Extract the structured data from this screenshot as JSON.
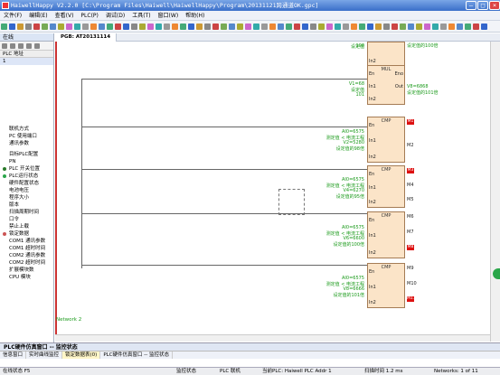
{
  "window": {
    "title": "HaiwellHappy V2.2.0 [C:\\Program Files\\Haiwell\\HaiwellHappy\\Program\\20131121跨通道OK.gpc]"
  },
  "menu": [
    "文件(F)",
    "编辑(E)",
    "查看(V)",
    "PLC(P)",
    "调试(D)",
    "工具(T)",
    "窗口(W)",
    "帮助(H)"
  ],
  "sidebar": {
    "header": "在线",
    "grid_header": "PLC 地址",
    "grid_row": "1",
    "items": [
      {
        "label": "联机方式",
        "dot": ""
      },
      {
        "label": "PC 使用端口",
        "dot": ""
      },
      {
        "label": "通讯参数",
        "dot": ""
      },
      {
        "label": "",
        "dot": ""
      },
      {
        "label": "目标PLC配置",
        "dot": ""
      },
      {
        "label": "PN",
        "dot": ""
      },
      {
        "label": "PLC 开关位置",
        "dot": "#2a7a2a"
      },
      {
        "label": "PLC运行状态",
        "dot": "#2aa64a"
      },
      {
        "label": "硬件配置状态",
        "dot": ""
      },
      {
        "label": "电池电压",
        "dot": ""
      },
      {
        "label": "程序大小",
        "dot": ""
      },
      {
        "label": "版本",
        "dot": ""
      },
      {
        "label": "扫描周期时间",
        "dot": ""
      },
      {
        "label": "口令",
        "dot": ""
      },
      {
        "label": "禁止上载",
        "dot": ""
      },
      {
        "label": "锁定数据",
        "dot": "#c55"
      },
      {
        "label": "COM1 通讯参数",
        "dot": ""
      },
      {
        "label": "COM1 超时时间",
        "dot": ""
      },
      {
        "label": "COM2 通讯参数",
        "dot": ""
      },
      {
        "label": "COM2 超时时间",
        "dot": ""
      },
      {
        "label": "扩展模块数",
        "dot": ""
      },
      {
        "label": "CPU 模块",
        "dot": ""
      }
    ]
  },
  "editor": {
    "tab": "PGB: AT20131114",
    "network_label": "Network 2",
    "blocks": [
      {
        "title": "",
        "in1": "",
        "in2": "In2",
        "en": "",
        "outs": [],
        "ops": [
          {
            "t": "设定值",
            "c": "#1a9a1a"
          },
          {
            "t": "100",
            "c": "#1a9a1a"
          }
        ],
        "right": "设定值的100倍"
      },
      {
        "title": "MUL",
        "in1": "In1",
        "in2": "In2",
        "en": "En",
        "eno": "Eno",
        "out": "Out",
        "ops": [
          {
            "t": "V1=68",
            "c": "#1a9a1a"
          },
          {
            "t": "设定值",
            "c": "#1a9a1a"
          },
          {
            "t": "101",
            "c": "#1a9a1a"
          }
        ],
        "right1": "V8=6868",
        "right2": "设定值的101倍"
      },
      {
        "title": "CMP",
        "in1": "In1",
        "in2": "In2",
        "en": "En",
        "outs": [
          {
            "t": "M1",
            "red": true
          },
          {
            "t": "M2",
            "red": false
          }
        ],
        "ops": [
          {
            "t": "AI0=6575",
            "c": "#1a9a1a"
          },
          {
            "t": "测定值 < 电流工程",
            "c": "#1a9a1a"
          },
          {
            "t": "V2=5280",
            "c": "#1a9a1a"
          },
          {
            "t": "设定值的98倍",
            "c": "#1a9a1a"
          }
        ]
      },
      {
        "title": "CMP",
        "in1": "In1",
        "in2": "In2",
        "en": "En",
        "outs": [
          {
            "t": "M3",
            "red": true
          },
          {
            "t": "M4",
            "red": false
          },
          {
            "t": "M5",
            "red": false
          }
        ],
        "ops": [
          {
            "t": "AI0=6575",
            "c": "#1a9a1a"
          },
          {
            "t": "测定值 < 电流工程",
            "c": "#1a9a1a"
          },
          {
            "t": "V4=6270",
            "c": "#1a9a1a"
          },
          {
            "t": "设定值的95倍",
            "c": "#1a9a1a"
          }
        ]
      },
      {
        "title": "CMP",
        "in1": "In1",
        "in2": "In2",
        "en": "En",
        "outs": [
          {
            "t": "M6",
            "red": false
          },
          {
            "t": "M7",
            "red": false
          },
          {
            "t": "M8",
            "red": true
          }
        ],
        "ops": [
          {
            "t": "AI0=6575",
            "c": "#1a9a1a"
          },
          {
            "t": "测定值 < 电流工程",
            "c": "#1a9a1a"
          },
          {
            "t": "V6=6600",
            "c": "#1a9a1a"
          },
          {
            "t": "设定值的100倍",
            "c": "#1a9a1a"
          }
        ]
      },
      {
        "title": "CMP",
        "in1": "In1",
        "in2": "In2",
        "en": "En",
        "outs": [
          {
            "t": "M9",
            "red": false
          },
          {
            "t": "M10",
            "red": false
          },
          {
            "t": "M11",
            "red": true
          }
        ],
        "ops": [
          {
            "t": "AI0=6575",
            "c": "#1a9a1a"
          },
          {
            "t": "测定值 < 电流工程",
            "c": "#1a9a1a"
          },
          {
            "t": "V8=6666",
            "c": "#1a9a1a"
          },
          {
            "t": "设定值的101倍",
            "c": "#1a9a1a"
          }
        ]
      }
    ]
  },
  "bottom": {
    "title": "PLC硬件仿真窗口 -- 监控状态",
    "tabs": [
      "信息窗口",
      "实时曲线监控",
      "锁定数据表(0)",
      "PLC硬件仿真窗口 -- 监控状态"
    ]
  },
  "status": {
    "device": "在线状态 F5",
    "monitor": "监控状态",
    "plc": "PLC 联机",
    "current": "当前PLC: Haiwell PLC Addr 1",
    "scan": "扫描时间 1.2 ms",
    "networks": "Networks: 1 of 11"
  }
}
